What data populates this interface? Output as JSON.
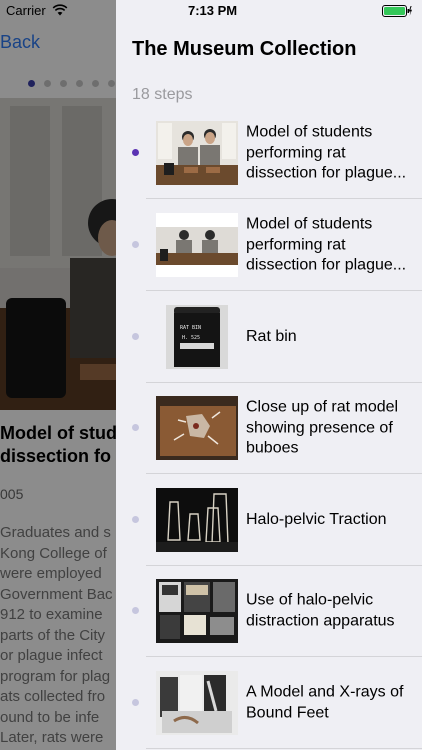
{
  "status": {
    "carrier": "Carrier",
    "time": "7:13 PM"
  },
  "background": {
    "back_label": "Back",
    "page_count": 9,
    "active_page": 0,
    "title_line1": "Model of stud",
    "title_line2": "dissection fo",
    "date": "005",
    "body_lines": [
      "Graduates and s",
      "Kong College of",
      "were employed",
      "Government Bac",
      "912 to examine",
      "parts of the City",
      "or plague infect",
      "program for plag",
      "ats collected fro",
      "ound to be infe",
      "Later, rats were"
    ]
  },
  "panel": {
    "title": "The Museum Collection",
    "steps_label": "18 steps",
    "accent": "#5b33b3",
    "items": [
      {
        "label": "Model of students performing rat dissection for plague...",
        "icon": "students-dissection-photo",
        "active": true
      },
      {
        "label": "Model of students performing rat dissection for plague...",
        "icon": "students-dissection-photo",
        "active": false
      },
      {
        "label": "Rat bin",
        "icon": "rat-bin-photo",
        "active": false
      },
      {
        "label": "Close up of rat model showing presence of buboes",
        "icon": "rat-model-photo",
        "active": false
      },
      {
        "label": "Halo-pelvic Traction",
        "icon": "halo-traction-photo",
        "active": false
      },
      {
        "label": "Use of halo-pelvic distraction apparatus",
        "icon": "halo-display-photo",
        "active": false
      },
      {
        "label": "A Model and X-rays of Bound Feet",
        "icon": "bound-feet-photo",
        "active": false
      }
    ]
  }
}
